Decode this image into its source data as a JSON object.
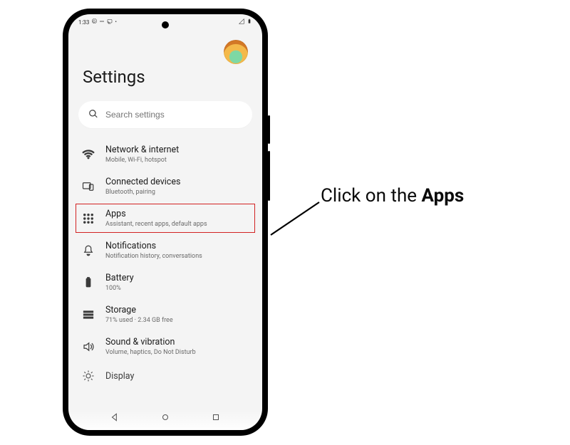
{
  "status": {
    "time": "1:33"
  },
  "header": {
    "title": "Settings"
  },
  "search": {
    "placeholder": "Search settings"
  },
  "items": {
    "network": {
      "label": "Network & internet",
      "sub": "Mobile, Wi-Fi, hotspot"
    },
    "devices": {
      "label": "Connected devices",
      "sub": "Bluetooth, pairing"
    },
    "apps": {
      "label": "Apps",
      "sub": "Assistant, recent apps, default apps"
    },
    "notifs": {
      "label": "Notifications",
      "sub": "Notification history, conversations"
    },
    "battery": {
      "label": "Battery",
      "sub": "100%"
    },
    "storage": {
      "label": "Storage",
      "sub": "71% used · 2.34 GB free"
    },
    "sound": {
      "label": "Sound & vibration",
      "sub": "Volume, haptics, Do Not Disturb"
    },
    "display": {
      "label": "Display",
      "sub": ""
    }
  },
  "callout": {
    "pre": "Click on the ",
    "bold": "Apps"
  }
}
